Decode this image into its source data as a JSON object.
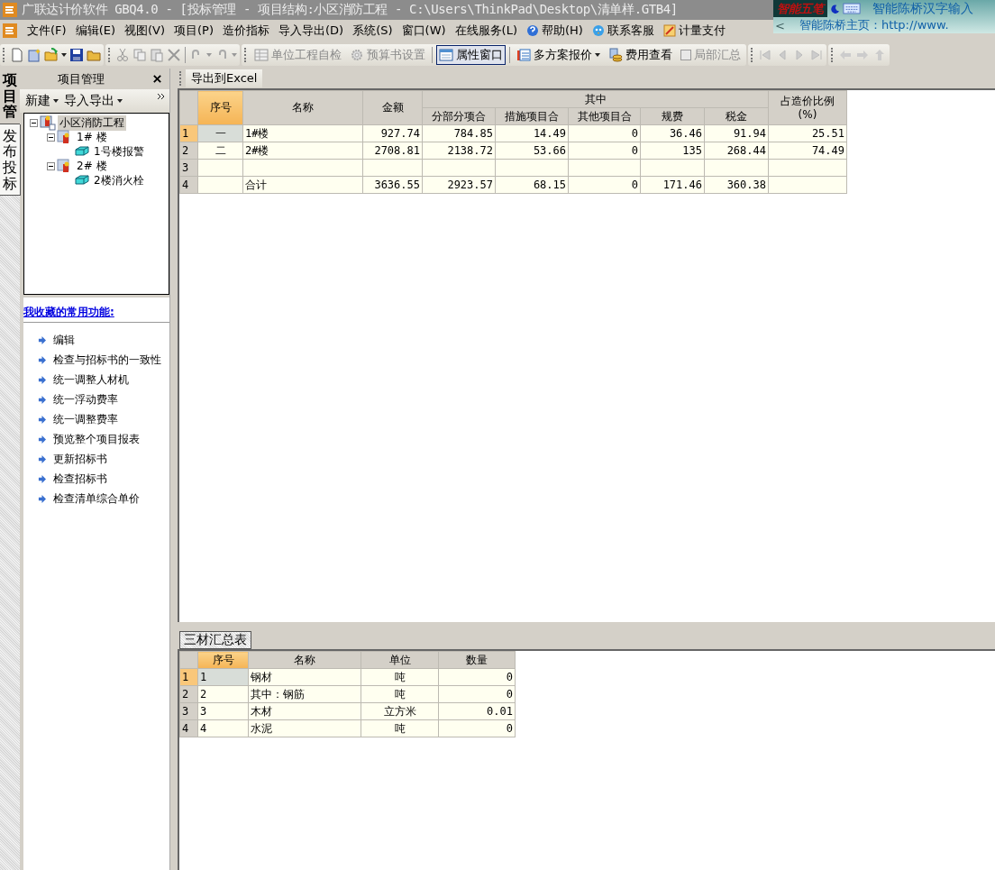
{
  "window": {
    "title": "广联达计价软件 GBQ4.0 - [投标管理 - 项目结构:小区消防工程 - C:\\Users\\ThinkPad\\Desktop\\清单样.GTB4]"
  },
  "ime_bar": {
    "logo": "智能五笔",
    "name": "智能陈桥汉字输入",
    "back": "<",
    "homepage": "智能陈桥主页：http://www."
  },
  "menu": [
    {
      "label": "文件(F)"
    },
    {
      "label": "编辑(E)"
    },
    {
      "label": "视图(V)"
    },
    {
      "label": "项目(P)"
    },
    {
      "label": "造价指标"
    },
    {
      "label": "导入导出(D)"
    },
    {
      "label": "系统(S)"
    },
    {
      "label": "窗口(W)"
    },
    {
      "label": "在线服务(L)"
    },
    {
      "label": "帮助(H)",
      "kind": "help"
    },
    {
      "label": "联系客服",
      "kind": "chat"
    },
    {
      "label": "计量支付",
      "kind": "edit"
    }
  ],
  "toolbar": [
    {
      "label": "单位工程自检",
      "kind": "grid",
      "disabled": true,
      "selected": false
    },
    {
      "label": "预算书设置",
      "kind": "gear",
      "disabled": true,
      "selected": false
    },
    {
      "label": "属性窗口",
      "kind": "window",
      "disabled": false,
      "selected": true
    },
    {
      "label": "多方案报价",
      "kind": "dropdown",
      "disabled": false,
      "selected": false
    },
    {
      "label": "费用查看",
      "kind": "coins",
      "disabled": false,
      "selected": false
    },
    {
      "label": "局部汇总",
      "kind": "check",
      "disabled": true,
      "selected": false
    }
  ],
  "side_tabs": [
    {
      "label": "项目管",
      "selected": true
    },
    {
      "label": "发布投标",
      "selected": false
    }
  ],
  "panel": {
    "title": "项目管理",
    "actions": [
      "新建",
      "导入导出"
    ]
  },
  "tree": [
    {
      "label": "小区消防工程",
      "selected": true,
      "expanded": true,
      "children": [
        {
          "label": "1# 楼",
          "selected": false,
          "expanded": true,
          "children": [
            {
              "label": "1号楼报警",
              "selected": false
            }
          ]
        },
        {
          "label": "2# 楼",
          "selected": false,
          "expanded": true,
          "children": [
            {
              "label": "2楼消火栓",
              "selected": false
            }
          ]
        }
      ]
    }
  ],
  "favorites": {
    "title": "我收藏的常用功能:",
    "items": [
      "编辑",
      "检查与招标书的一致性",
      "统一调整人材机",
      "统一浮动费率",
      "统一调整费率",
      "预览整个项目报表",
      "更新招标书",
      "检查招标书",
      "检查清单综合单价"
    ]
  },
  "main_tab": "导出到Excel",
  "table": {
    "columns": [
      {
        "label": "序号",
        "kind": "index",
        "selected": true
      },
      {
        "label": "名称",
        "kind": "text",
        "selected": false
      },
      {
        "label": "金额",
        "kind": "number",
        "selected": false
      },
      {
        "label": "其中",
        "colspan": 5,
        "children": [
          {
            "label": "分部分项合",
            "kind": "number",
            "selected": false
          },
          {
            "label": "措施项目合",
            "kind": "number",
            "selected": false
          },
          {
            "label": "其他项目合",
            "kind": "number",
            "selected": false
          },
          {
            "label": "规费",
            "kind": "number",
            "selected": false
          },
          {
            "label": "税金",
            "kind": "number",
            "selected": false
          }
        ]
      },
      {
        "label": "占造价比例\n(%)",
        "kind": "number",
        "selected": false
      }
    ],
    "rows": [
      {
        "number": "1",
        "selected": true,
        "cells": [
          "一",
          "1#楼",
          "927.74",
          "784.85",
          "14.49",
          "0",
          "36.46",
          "91.94",
          "25.51"
        ]
      },
      {
        "number": "2",
        "selected": false,
        "cells": [
          "二",
          "2#楼",
          "2708.81",
          "2138.72",
          "53.66",
          "0",
          "135",
          "268.44",
          "74.49"
        ]
      },
      {
        "number": "3",
        "selected": false,
        "cells": [
          "",
          "",
          "",
          "",
          "",
          "",
          "",
          "",
          ""
        ]
      },
      {
        "number": "4",
        "selected": false,
        "cells": [
          "",
          "合计",
          "3636.55",
          "2923.57",
          "68.15",
          "0",
          "171.46",
          "360.38",
          ""
        ]
      }
    ]
  },
  "bottom_tab": {
    "label": "三材汇总表",
    "selected": true
  },
  "materials": {
    "columns": [
      {
        "label": "序号",
        "kind": "text",
        "selected": true
      },
      {
        "label": "名称",
        "kind": "text",
        "selected": false
      },
      {
        "label": "单位",
        "kind": "index",
        "selected": false
      },
      {
        "label": "数量",
        "kind": "number",
        "selected": false
      }
    ],
    "rows": [
      {
        "number": "1",
        "selected": true,
        "cells": [
          "1",
          "钢材",
          "吨",
          "0"
        ]
      },
      {
        "number": "2",
        "selected": false,
        "cells": [
          "2",
          "其中：钢筋",
          "吨",
          "0"
        ]
      },
      {
        "number": "3",
        "selected": false,
        "cells": [
          "3",
          "木材",
          "立方米",
          "0.01"
        ]
      },
      {
        "number": "4",
        "selected": false,
        "cells": [
          "4",
          "水泥",
          "吨",
          "0"
        ]
      }
    ]
  }
}
